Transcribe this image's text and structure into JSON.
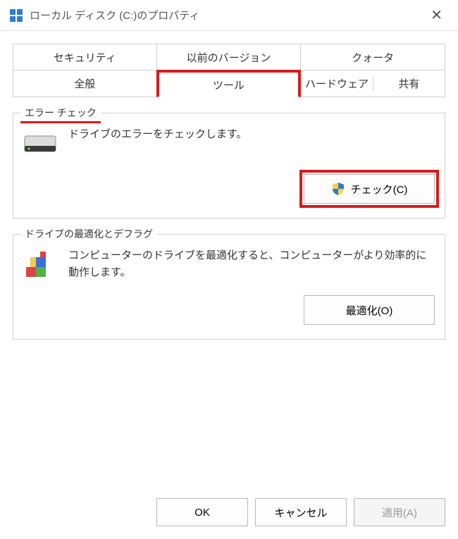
{
  "title": "ローカル ディスク (C:)のプロパティ",
  "tabs": {
    "rowA": [
      "セキュリティ",
      "以前のバージョン",
      "クォータ"
    ],
    "rowB": [
      "全般",
      "ツール",
      "ハードウェア",
      "共有"
    ],
    "active": "ツール"
  },
  "errorCheck": {
    "legend": "エラー チェック",
    "desc": "ドライブのエラーをチェックします。",
    "button": "チェック(C)"
  },
  "optimize": {
    "legend": "ドライブの最適化とデフラグ",
    "desc": "コンピューターのドライブを最適化すると、コンピューターがより効率的に動作します。",
    "button": "最適化(O)"
  },
  "footer": {
    "ok": "OK",
    "cancel": "キャンセル",
    "apply": "適用(A)"
  }
}
